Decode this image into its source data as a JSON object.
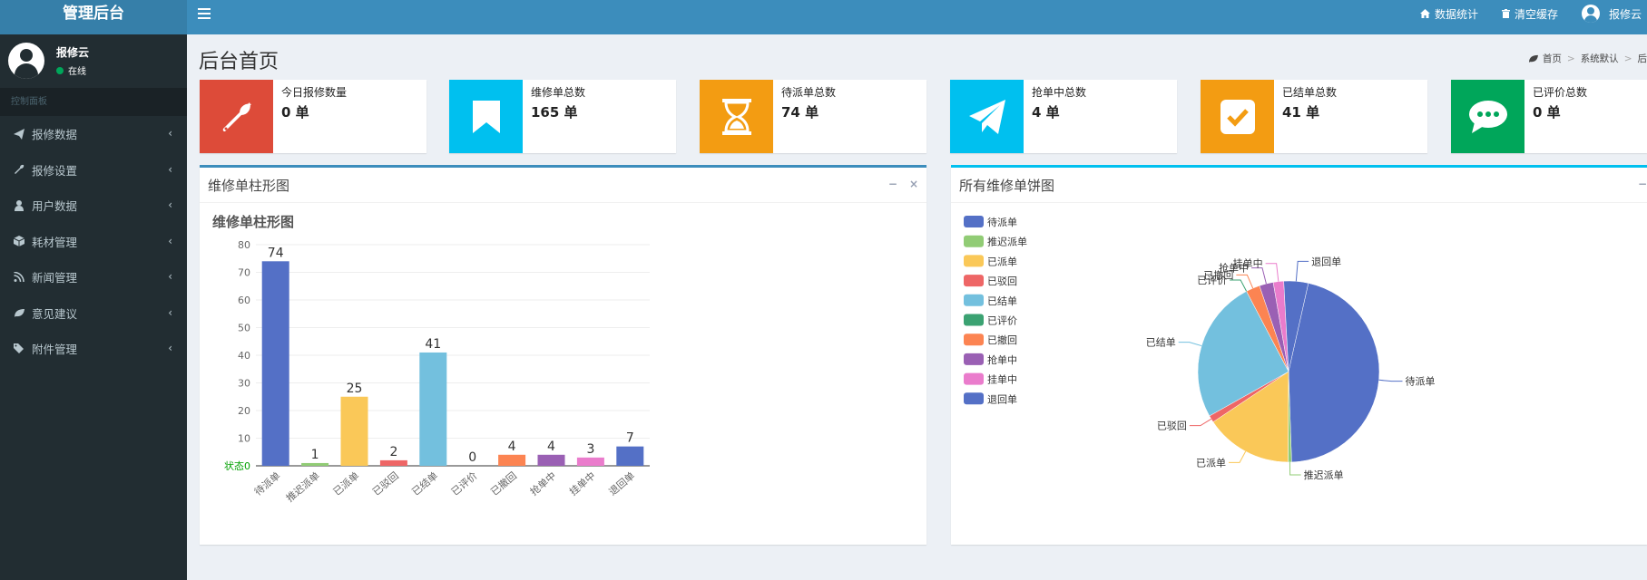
{
  "header": {
    "logo": "管理后台",
    "nav": [
      {
        "icon": "home-icon",
        "label": "数据统计"
      },
      {
        "icon": "trash-icon",
        "label": "清空缓存"
      },
      {
        "icon": "user-avatar-icon",
        "label": "报修云"
      }
    ]
  },
  "sidebar": {
    "user": {
      "name": "报修云",
      "status": "在线"
    },
    "section_header": "控制面板",
    "items": [
      {
        "icon": "paper-plane-icon",
        "label": "报修数据"
      },
      {
        "icon": "wrench-icon",
        "label": "报修设置"
      },
      {
        "icon": "user-icon",
        "label": "用户数据"
      },
      {
        "icon": "cube-icon",
        "label": "耗材管理"
      },
      {
        "icon": "rss-icon",
        "label": "新闻管理"
      },
      {
        "icon": "leaf-icon",
        "label": "意见建议"
      },
      {
        "icon": "tags-icon",
        "label": "附件管理"
      }
    ]
  },
  "page": {
    "title": "后台首页",
    "breadcrumb": [
      "首页",
      "系统默认",
      "后"
    ]
  },
  "info_boxes": [
    {
      "icon": "wrench-icon",
      "color": "#dd4b39",
      "label": "今日报修数量",
      "value": "0 单"
    },
    {
      "icon": "bookmark-icon",
      "color": "#00c0ef",
      "label": "维修单总数",
      "value": "165 单"
    },
    {
      "icon": "hourglass-icon",
      "color": "#f39c12",
      "label": "待派单总数",
      "value": "74 单"
    },
    {
      "icon": "paper-plane-icon",
      "color": "#00c0ef",
      "label": "抢单中总数",
      "value": "4 单"
    },
    {
      "icon": "check-square-icon",
      "color": "#f39c12",
      "label": "已结单总数",
      "value": "41 单"
    },
    {
      "icon": "comment-icon",
      "color": "#00a65a",
      "label": "已评价总数",
      "value": "0 单"
    }
  ],
  "bar_panel": {
    "title": "维修单柱形图",
    "minimize": "−",
    "close": "×"
  },
  "pie_panel": {
    "title": "所有维修单饼图",
    "minimize": "−"
  },
  "chart_data": [
    {
      "type": "bar",
      "title": "维修单柱形图",
      "xlabel": "状态",
      "ylabel": "",
      "ylim": [
        0,
        80
      ],
      "yticks": [
        0,
        10,
        20,
        30,
        40,
        50,
        60,
        70,
        80
      ],
      "categories": [
        "待派单",
        "推迟派单",
        "已派单",
        "已驳回",
        "已结单",
        "已评价",
        "已撤回",
        "抢单中",
        "挂单中",
        "退回单"
      ],
      "values": [
        74,
        1,
        25,
        2,
        41,
        0,
        4,
        4,
        3,
        7
      ],
      "colors": [
        "#5470c6",
        "#91cc75",
        "#fac858",
        "#ee6666",
        "#73c0de",
        "#3ba272",
        "#fc8452",
        "#9a60b4",
        "#ea7ccc",
        "#5470c6"
      ],
      "grid": true
    },
    {
      "type": "pie",
      "title": "",
      "legend_position": "top-left",
      "labels": [
        "待派单",
        "推迟派单",
        "已派单",
        "已驳回",
        "已结单",
        "已评价",
        "已撤回",
        "抢单中",
        "挂单中",
        "退回单"
      ],
      "values": [
        74,
        1,
        25,
        2,
        41,
        0,
        4,
        4,
        3,
        7
      ],
      "colors": [
        "#5470c6",
        "#91cc75",
        "#fac858",
        "#ee6666",
        "#73c0de",
        "#3ba272",
        "#fc8452",
        "#9a60b4",
        "#ea7ccc",
        "#5470c6"
      ]
    }
  ]
}
